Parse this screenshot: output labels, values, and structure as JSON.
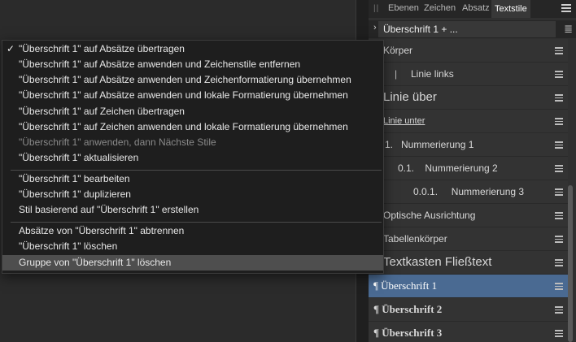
{
  "panel": {
    "tabs": [
      "Ebenen",
      "Zeichen",
      "Absatz",
      "Textstile"
    ],
    "active_tab": "Textstile",
    "current_style": "Überschrift 1 + ..."
  },
  "styles": [
    {
      "label": "Körper"
    },
    {
      "label": "Linie links"
    },
    {
      "label": "Linie über"
    },
    {
      "label": "Linie unter"
    },
    {
      "label": "1.   Nummerierung 1"
    },
    {
      "label": "0.1.    Nummerierung 2"
    },
    {
      "label": "0.0.1.     Nummerierung 3"
    },
    {
      "label": "Optische Ausrichtung"
    },
    {
      "label": "Tabellenkörper"
    },
    {
      "label": "Textkasten Fließtext"
    },
    {
      "label": "¶ Überschrift 1"
    },
    {
      "label": "¶ Überschrift 2"
    },
    {
      "label": "¶ Überschrift 3"
    }
  ],
  "context_menu": {
    "items": [
      {
        "label": "\"Überschrift 1\" auf Absätze übertragen",
        "checked": "✓"
      },
      {
        "label": "\"Überschrift 1\" auf Absätze anwenden und Zeichenstile entfernen"
      },
      {
        "label": "\"Überschrift 1\" auf Absätze anwenden und Zeichenformatierung übernehmen"
      },
      {
        "label": "\"Überschrift 1\" auf Absätze anwenden und lokale Formatierung übernehmen"
      },
      {
        "label": "\"Überschrift 1\" auf Zeichen übertragen"
      },
      {
        "label": "\"Überschrift 1\" auf Zeichen anwenden und lokale Formatierung übernehmen"
      },
      {
        "label": "\"Überschrift 1\" anwenden, dann Nächste Stile"
      },
      {
        "label": "\"Überschrift 1\" aktualisieren"
      },
      {
        "label": "\"Überschrift 1\" bearbeiten"
      },
      {
        "label": "\"Überschrift 1\" duplizieren"
      },
      {
        "label": "Stil basierend auf \"Überschrift 1\" erstellen"
      },
      {
        "label": "Absätze von \"Überschrift 1\" abtrennen"
      },
      {
        "label": "\"Überschrift 1\" löschen"
      },
      {
        "label": "Gruppe von \"Überschrift 1\" löschen"
      }
    ]
  }
}
